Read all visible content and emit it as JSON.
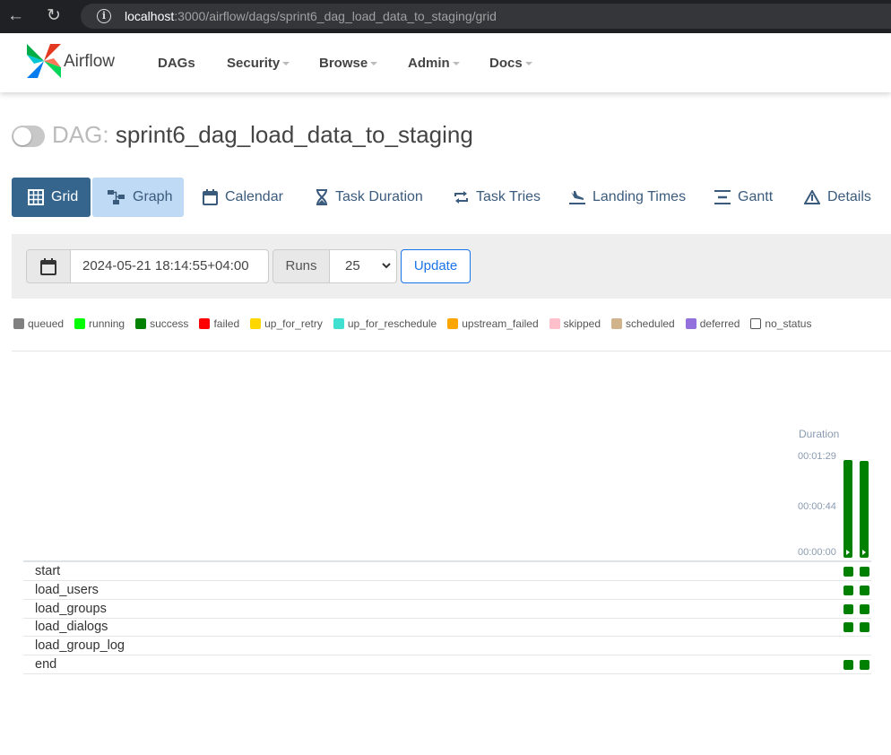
{
  "browser": {
    "url_host": "localhost",
    "url_rest": ":3000/airflow/dags/sprint6_dag_load_data_to_staging/grid"
  },
  "header": {
    "brand": "Airflow",
    "menu": [
      "DAGs",
      "Security",
      "Browse",
      "Admin",
      "Docs"
    ]
  },
  "dag": {
    "prefix": "DAG:",
    "id": "sprint6_dag_load_data_to_staging",
    "paused": true
  },
  "tabs": [
    "Grid",
    "Graph",
    "Calendar",
    "Task Duration",
    "Task Tries",
    "Landing Times",
    "Gantt",
    "Details"
  ],
  "filters": {
    "base_date": "2024-05-21 18:14:55+04:00",
    "runs_label": "Runs",
    "runs_value": "25",
    "update_label": "Update"
  },
  "legend": [
    {
      "label": "queued",
      "color": "#808080"
    },
    {
      "label": "running",
      "color": "#00ff00"
    },
    {
      "label": "success",
      "color": "#008000"
    },
    {
      "label": "failed",
      "color": "#ff0000"
    },
    {
      "label": "up_for_retry",
      "color": "#ffd700"
    },
    {
      "label": "up_for_reschedule",
      "color": "#40e0d0"
    },
    {
      "label": "upstream_failed",
      "color": "#ffa500"
    },
    {
      "label": "skipped",
      "color": "#ffc0cb"
    },
    {
      "label": "scheduled",
      "color": "#d2b48c"
    },
    {
      "label": "deferred",
      "color": "#9370db"
    },
    {
      "label": "no_status",
      "color": "#ffffff"
    }
  ],
  "grid": {
    "duration_label": "Duration",
    "ticks": [
      "00:01:29",
      "00:00:44",
      "00:00:00"
    ],
    "runs": [
      {
        "duration_fraction": 0.96,
        "state": "success"
      },
      {
        "duration_fraction": 0.95,
        "state": "success"
      }
    ],
    "tasks": [
      {
        "name": "start",
        "instances": [
          "success",
          "success"
        ]
      },
      {
        "name": "load_users",
        "instances": [
          "success",
          "success"
        ]
      },
      {
        "name": "load_groups",
        "instances": [
          "success",
          "success"
        ]
      },
      {
        "name": "load_dialogs",
        "instances": [
          "success",
          "success"
        ]
      },
      {
        "name": "load_group_log",
        "instances": []
      },
      {
        "name": "end",
        "instances": [
          "success",
          "success"
        ]
      }
    ]
  },
  "colors": {
    "success": "#008000",
    "primary": "#35658d",
    "link": "#1a73e8"
  }
}
